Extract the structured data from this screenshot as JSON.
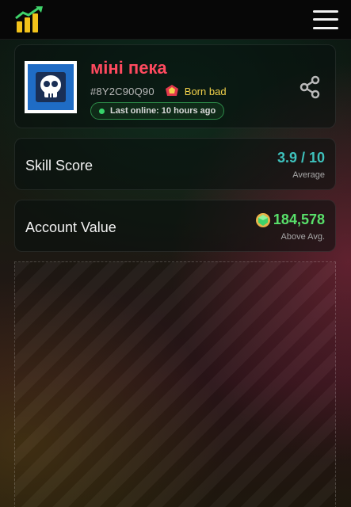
{
  "header": {
    "logo_icon": "bar-chart-growth-icon",
    "menu_icon": "hamburger-menu-icon"
  },
  "profile": {
    "name": "міні пека",
    "tag": "#8Y2C90Q90",
    "club": "Born bad",
    "club_icon": "club-badge-icon",
    "last_online": "Last online: 10 hours ago",
    "avatar_icon": "skull-icon",
    "share_icon": "share-icon"
  },
  "skill": {
    "label": "Skill Score",
    "value": "3.9 / 10",
    "sub": "Average"
  },
  "account": {
    "label": "Account Value",
    "value": "184,578",
    "sub": "Above Avg.",
    "gem_icon": "gem-icon"
  },
  "colors": {
    "name": "#ff4a5f",
    "club": "#f2d14a",
    "skill_value": "#3ec1bc",
    "account_value": "#58e06a",
    "online_dot": "#37d36a"
  }
}
